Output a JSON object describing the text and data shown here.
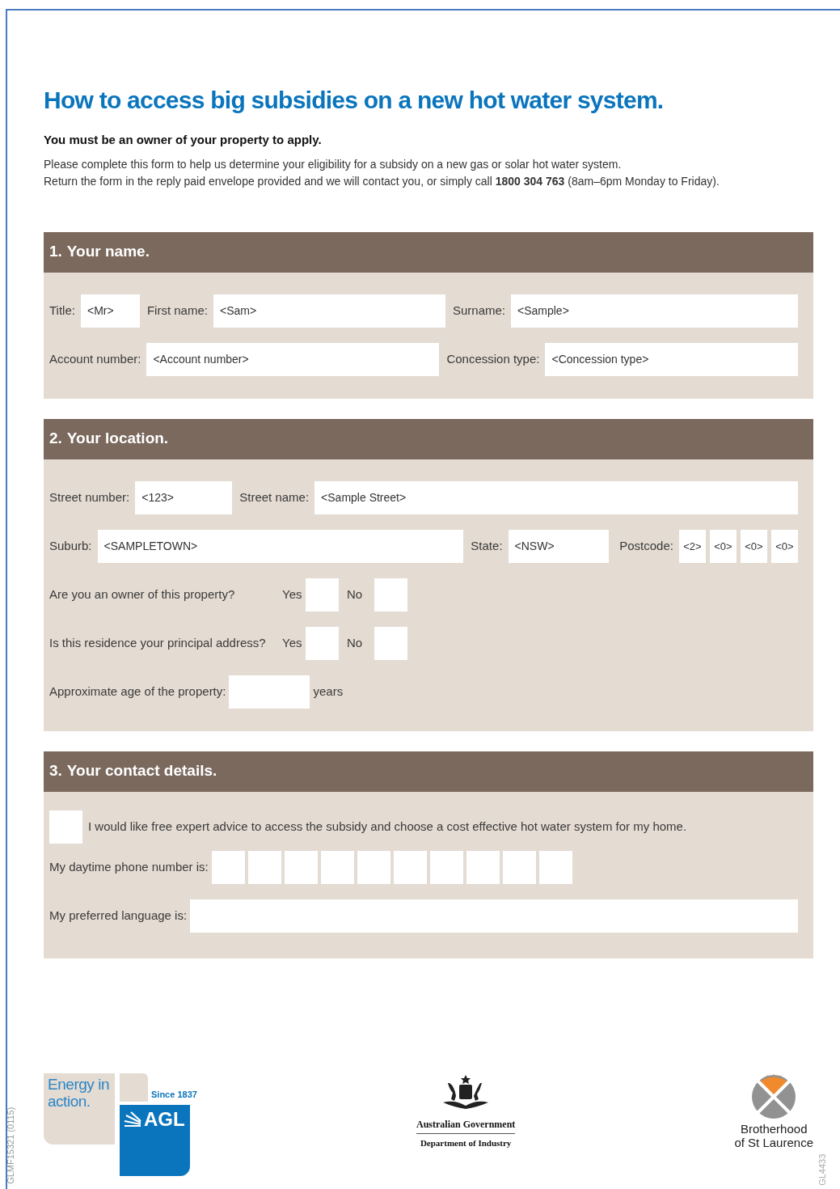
{
  "heading": "How to access big subsidies on a new hot water system.",
  "requirement": "You must be an owner of your property to apply.",
  "intro": [
    "Please complete this form to help us determine your eligibility for a subsidy on a new gas or solar hot water system.",
    "Return the form in the reply paid envelope provided and we will contact you, or simply call **1800 304 763** (8am–6pm Monday to Friday)."
  ],
  "sections": [
    {
      "number": "1.",
      "title": "Your name.",
      "rows": [
        {
          "kind": "fields",
          "fields": [
            {
              "label": "Title:",
              "value": "<Mr>"
            },
            {
              "label": "First name:",
              "value": "<Sam>"
            },
            {
              "label": "Surname:",
              "value": "<Sample>"
            }
          ]
        },
        {
          "kind": "fields",
          "fields": [
            {
              "label": "Account number:",
              "value": "<Account number>"
            },
            {
              "label": "Concession type:",
              "value": "<Concession type>"
            }
          ]
        }
      ]
    },
    {
      "number": "2.",
      "title": "Your location.",
      "rows": [
        {
          "kind": "fields",
          "fields": [
            {
              "label": "Street number:",
              "value": "<123>"
            },
            {
              "label": "Street name:",
              "value": "<Sample Street>"
            }
          ]
        },
        {
          "kind": "fields",
          "fields": [
            {
              "label": "Suburb:",
              "value": "<SAMPLETOWN>"
            },
            {
              "label": "State:",
              "value": "<NSW>"
            }
          ],
          "postcode": {
            "label": "Postcode:",
            "digits": [
              "<2>",
              "<0>",
              "<0>",
              "<0>"
            ]
          }
        },
        {
          "kind": "question",
          "question": "Are you an owner of this property?",
          "options": [
            {
              "label": "Yes",
              "checked": false
            },
            {
              "label": "No",
              "checked": false
            }
          ]
        },
        {
          "kind": "question",
          "question": "Is this residence your principal address?",
          "options": [
            {
              "label": "Yes",
              "checked": false
            },
            {
              "label": "No",
              "checked": false
            }
          ]
        },
        {
          "kind": "age",
          "label": "Approximate age of the property:",
          "unit": "years"
        }
      ]
    },
    {
      "number": "3.",
      "title": "Your contact details.",
      "rows": [
        {
          "kind": "consent",
          "checked": false,
          "text": "I would like free expert advice to access the subsidy and choose a cost effective hot water system for my home."
        },
        {
          "kind": "phone",
          "label": "My daytime phone number is:"
        },
        {
          "kind": "line",
          "label": "My preferred language is:"
        }
      ]
    }
  ],
  "footer": {
    "energy": [
      "Energy in",
      "action."
    ],
    "since": "Since 1837",
    "agl": "AGL",
    "gov": "Australian Government",
    "dept": "Department of Industry",
    "bsl": [
      "Brotherhood",
      "of St Laurence"
    ]
  },
  "codes": [
    "GLMF15321 (0115)",
    "GL4433"
  ]
}
